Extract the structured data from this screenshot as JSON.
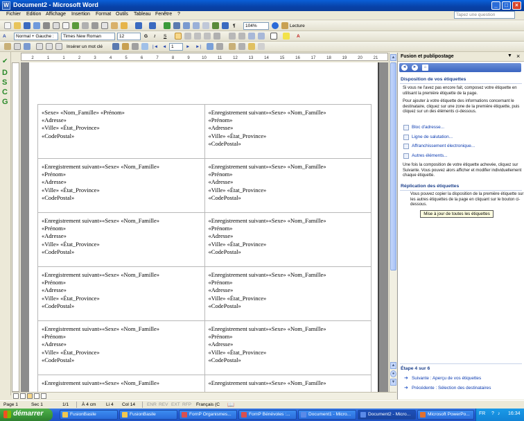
{
  "window": {
    "title": "Document2 - Microsoft Word"
  },
  "menu": [
    "Fichier",
    "Edition",
    "Affichage",
    "Insertion",
    "Format",
    "Outils",
    "Tableau",
    "Fenêtre",
    "?"
  ],
  "help_placeholder": "Tapez une question",
  "toolbar1": {
    "zoom": "104%",
    "lecture": "Lecture"
  },
  "toolbar2": {
    "style": "Normal + Gauche :",
    "font": "Times New Roman",
    "size": "12"
  },
  "toolbar3": {
    "insert_field": "Insérer un mot clé",
    "record": "1"
  },
  "dscg_letters": [
    "D",
    "S",
    "C",
    "G"
  ],
  "ruler_marks": [
    "2",
    "1",
    "1",
    "2",
    "3",
    "4",
    "5",
    "6",
    "7",
    "8",
    "9",
    "10",
    "11",
    "12",
    "13",
    "14",
    "15",
    "16",
    "17",
    "18",
    "19",
    "20",
    "21"
  ],
  "labels": [
    [
      [
        "«Sexe» «Nom_Famille» «Prénom»",
        "«Adresse»",
        "«Ville»  «État_Province»",
        "«CodePostal»"
      ],
      [
        "«Enregistrement suivant»«Sexe» «Nom_Famille»",
        "«Prénom»",
        "«Adresse»",
        "«Ville»  «État_Province»",
        "«CodePostal»"
      ]
    ],
    [
      [
        "«Enregistrement suivant»«Sexe» «Nom_Famille»",
        "«Prénom»",
        "«Adresse»",
        "«Ville»  «État_Province»",
        "«CodePostal»"
      ],
      [
        "«Enregistrement suivant»«Sexe» «Nom_Famille»",
        "«Prénom»",
        "«Adresse»",
        "«Ville»  «État_Province»",
        "«CodePostal»"
      ]
    ],
    [
      [
        "«Enregistrement suivant»«Sexe» «Nom_Famille»",
        "«Prénom»",
        "«Adresse»",
        "«Ville»  «État_Province»",
        "«CodePostal»"
      ],
      [
        "«Enregistrement suivant»«Sexe» «Nom_Famille»",
        "«Prénom»",
        "«Adresse»",
        "«Ville»  «État_Province»",
        "«CodePostal»"
      ]
    ],
    [
      [
        "«Enregistrement suivant»«Sexe» «Nom_Famille»",
        "«Prénom»",
        "«Adresse»",
        "«Ville»  «État_Province»",
        "«CodePostal»"
      ],
      [
        "«Enregistrement suivant»«Sexe» «Nom_Famille»",
        "«Prénom»",
        "«Adresse»",
        "«Ville»  «État_Province»",
        "«CodePostal»"
      ]
    ],
    [
      [
        "«Enregistrement suivant»«Sexe» «Nom_Famille»",
        "«Prénom»",
        "«Adresse»",
        "«Ville»  «État_Province»",
        "«CodePostal»"
      ],
      [
        "«Enregistrement suivant»«Sexe» «Nom_Famille»",
        "«Prénom»",
        "«Adresse»",
        "«Ville»  «État_Province»",
        "«CodePostal»"
      ]
    ],
    [
      [
        "«Enregistrement suivant»«Sexe» «Nom_Famille»"
      ],
      [
        "«Enregistrement suivant»«Sexe» «Nom_Famille»"
      ]
    ]
  ],
  "taskpane": {
    "title": "Fusion et publipostage",
    "section1": {
      "heading": "Disposition de vos étiquettes",
      "p1": "Si vous ne l'avez pas encore fait, composez votre étiquette en utilisant la première étiquette de la page.",
      "p2": "Pour ajouter à votre étiquette des informations concernant le destinataire, cliquez sur une zone de la première étiquette, puis cliquez sur un des éléments ci-dessous.",
      "links": [
        "Bloc d'adresse...",
        "Ligne de salutation...",
        "Affranchissement électronique...",
        "Autres éléments..."
      ],
      "p3": "Une fois la composition de votre étiquette achevée, cliquez sur Suivante. Vous pouvez alors afficher et modifier individuellement chaque étiquette."
    },
    "section2": {
      "heading": "Réplication des étiquettes",
      "p1": "Vous pouvez copier la disposition de la première étiquette sur les autres étiquettes de la page en cliquant sur le bouton ci-dessous.",
      "button": "Mise à jour de toutes les étiquettes"
    },
    "step": "Étape 4 sur 6",
    "next": "Suivante : Aperçu de vos étiquettes",
    "prev": "Précédente : Sélection des destinataires"
  },
  "status": {
    "page": "Page 1",
    "sec": "Sec 1",
    "pages": "1/1",
    "at": "À 4 cm",
    "li": "Li 4",
    "col": "Col 14",
    "enr": "ENR",
    "rev": "REV",
    "ext": "EXT",
    "rfp": "RFP",
    "lang": "Français (C"
  },
  "taskbar": {
    "start": "démarrer",
    "apps": [
      "FusionBasile",
      "FusionBasile",
      "FornP Organismes...",
      "FornP Bénévoles :...",
      "Document1 - Micro...",
      "Document2 - Micro...",
      "Microsoft PowerPo..."
    ],
    "lang": "FR",
    "clock": "16:34"
  }
}
